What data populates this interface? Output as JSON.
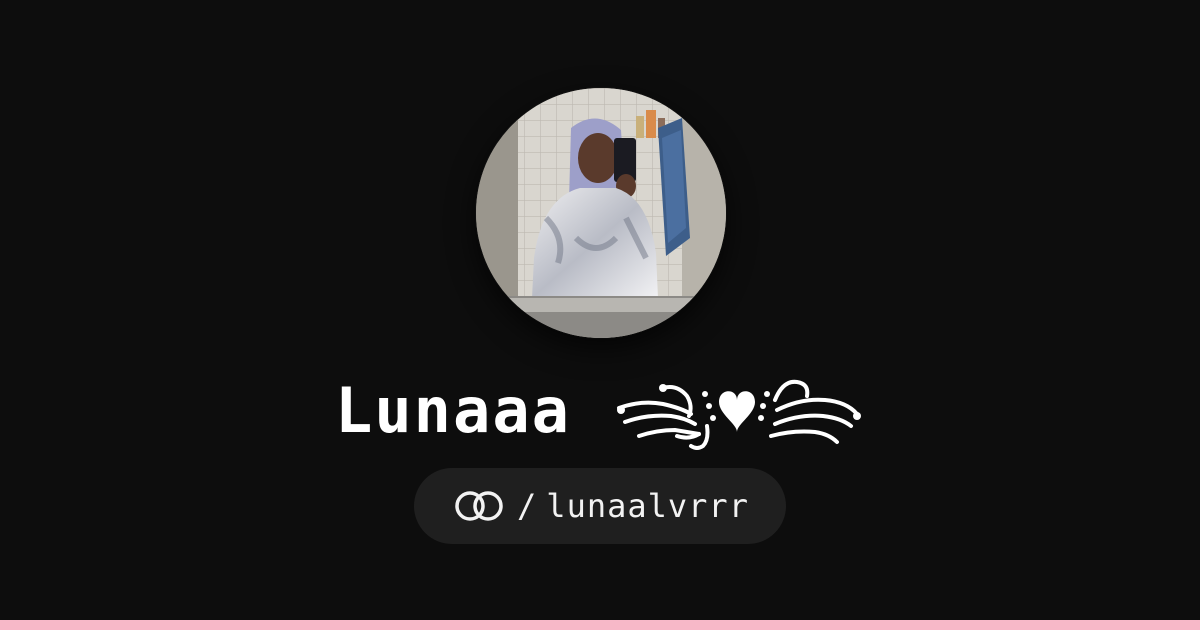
{
  "profile": {
    "display_name": "Lunaaa",
    "separator": "/",
    "username": "lunaalvrrr"
  },
  "icons": {
    "link": "linked-rings-icon",
    "name_decoration": "swirl-heart-ornament-icon",
    "avatar": "profile-photo"
  },
  "colors": {
    "background": "#0d0d0d",
    "text": "#ffffff",
    "pill_background": "#1f1f1f",
    "bottom_accent": "#f7b8c8"
  }
}
